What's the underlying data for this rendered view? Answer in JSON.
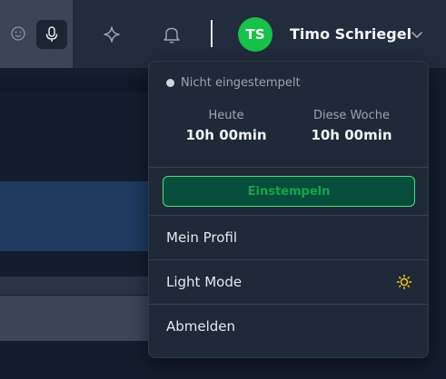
{
  "header": {
    "icons": {
      "emoji": "smiley-icon",
      "mic": "microphone-icon",
      "sparkle": "sparkle-icon",
      "bell": "bell-icon",
      "chevron": "chevron-down-icon"
    },
    "user": {
      "initials": "TS",
      "name": "Timo Schriegel",
      "avatar_color": "#16c24a"
    }
  },
  "dropdown": {
    "status_text": "Nicht eingestempelt",
    "today": {
      "label": "Heute",
      "value": "10h 00min"
    },
    "week": {
      "label": "Diese Woche",
      "value": "10h 00min"
    },
    "clock_in_label": "Einstempeln",
    "menu": {
      "profile": "Mein Profil",
      "light_mode": "Light Mode",
      "logout": "Abmelden"
    },
    "colors": {
      "clock_in_bg": "#064e3b",
      "clock_in_border": "#4ade80",
      "sun": "#facc15"
    }
  }
}
